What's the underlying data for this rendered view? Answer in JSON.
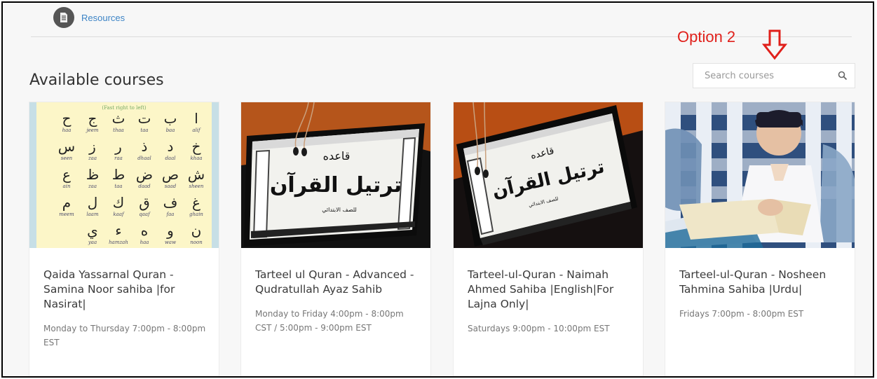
{
  "nav": {
    "resources_label": "Resources"
  },
  "annotation": {
    "option_label": "Option 2"
  },
  "page": {
    "title": "Available courses"
  },
  "search": {
    "placeholder": "Search courses"
  },
  "courses": [
    {
      "title": "Qaida Yassarnal Quran - Samina Noor sahiba |for Nasirat|",
      "schedule": "Monday to Thursday 7:00pm - 8:00pm EST"
    },
    {
      "title": "Tarteel ul Quran - Advanced - Qudratullah Ayaz Sahib",
      "schedule": "Monday to Friday 4:00pm - 8:00pm CST / 5:00pm - 9:00pm EST"
    },
    {
      "title": "Tarteel-ul-Quran - Naimah Ahmed Sahiba |English|For Lajna Only|",
      "schedule": "Saturdays 9:00pm - 10:00pm EST"
    },
    {
      "title": "Tarteel-ul-Quran - Nosheen Tahmina Sahiba |Urdu|",
      "schedule": "Fridays 7:00pm - 8:00pm EST"
    }
  ],
  "images": {
    "alphabet_chart": {
      "header": "(Fast right to left)",
      "rows": [
        {
          "letters": [
            "ا",
            "ب",
            "ت",
            "ث",
            "ج",
            "ح"
          ],
          "names": [
            "alif",
            "baa",
            "taa",
            "thaa",
            "jeem",
            "haa"
          ]
        },
        {
          "letters": [
            "خ",
            "د",
            "ذ",
            "ر",
            "ز",
            "س"
          ],
          "names": [
            "khaa",
            "daal",
            "dhaal",
            "raa",
            "zaa",
            "seen"
          ]
        },
        {
          "letters": [
            "ش",
            "ص",
            "ض",
            "ط",
            "ظ",
            "ع"
          ],
          "names": [
            "sheen",
            "saad",
            "daad",
            "taa",
            "zaa",
            "ain"
          ]
        },
        {
          "letters": [
            "غ",
            "ف",
            "ق",
            "ك",
            "ل",
            "م"
          ],
          "names": [
            "ghain",
            "faa",
            "qaaf",
            "kaaf",
            "laam",
            "meem"
          ]
        },
        {
          "letters": [
            "ن",
            "و",
            "ه",
            "ء",
            "ي"
          ],
          "names": [
            "noon",
            "waw",
            "haa",
            "hamzah",
            "yaa"
          ]
        }
      ]
    },
    "screen_text": {
      "top": "قاعده",
      "main": "ترتيل القرآن",
      "bottom": "للصف الابتدائي"
    }
  }
}
